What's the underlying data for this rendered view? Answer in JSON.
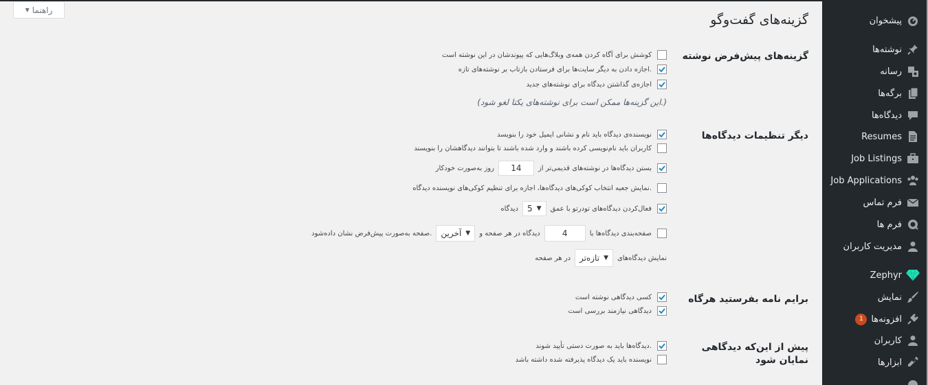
{
  "help_tab": {
    "label": "راهنما"
  },
  "page": {
    "title": "گزینه‌های گفت‌وگو"
  },
  "sections": {
    "default_post": {
      "heading": "گزینه‌های پیش‌فرض نوشته",
      "options": [
        {
          "label": "کوشش برای آگاه کردن همه‌ی وبلاگ‌هایی که پیوندشان در این نوشته است",
          "checked": false
        },
        {
          "label": "اجازه دادن به دیگر سایت‌ها برای فرستادن بازتاب بر نوشته‌های تازه.",
          "checked": true
        },
        {
          "label": "اجازه‌ی گذاشتن دیدگاه برای نوشته‌های جدید",
          "checked": true
        }
      ],
      "note": "(این گزینه‌ها ممکن است برای نوشته‌های یکتا لغو شود.)"
    },
    "other": {
      "heading": "دیگر تنظیمات دیدگاه‌ها",
      "require_name_email": {
        "label": "نویسنده‌ی دیدگاه باید نام و نشانی ایمیل خود را بنویسد",
        "checked": true
      },
      "registration_required": {
        "label": "کاربران باید نام‌نویسی کرده باشند و وارد شده باشند تا بتوانند دیدگاهشان را بنویسند",
        "checked": false
      },
      "close_comments": {
        "before": "بستن دیدگاه‌ها در نوشته‌های قدیمی‌تر از",
        "value": "14",
        "after": "روز به‌صورت خودکار",
        "checked": true
      },
      "cookies_optin": {
        "label": "نمایش جعبه انتخاب کوکی‌های دیدگاه‌ها، اجازه برای تنظیم کوکی‌های نویسنده دیدگاه.",
        "checked": false
      },
      "threaded": {
        "before": "فعال‌کردن دیدگاه‌های تودرتو با عمق",
        "value": "5",
        "after": "دیدگاه",
        "checked": true
      },
      "paged": {
        "before": "صفحه‌بندی دیدگاه‌ها با",
        "value": "4",
        "middle": "دیدگاه در هر صفحه و",
        "select": "آخرین",
        "after": "صفحه به‌صورت پیش‌فرض نشان داده‌شود.",
        "checked": false
      },
      "order": {
        "before": "نمایش دیدگاه‌های",
        "select": "تازه‌تر",
        "after": "در هر صفحه"
      }
    },
    "email_me": {
      "heading": "برایم نامه بفرستید هرگاه",
      "options": [
        {
          "label": "کسی دیدگاهی نوشته است",
          "checked": true
        },
        {
          "label": "دیدگاهی نیازمند بررسی است",
          "checked": true
        }
      ]
    },
    "before_appears": {
      "heading": "پیش از این‌که دیدگاهی نمایان شود",
      "options": [
        {
          "label": "دیدگاه‌ها باید به صورت دستی تأیید شوند.",
          "checked": true
        },
        {
          "label": "نویسنده باید یک دیدگاه پذیرفته شده داشته باشد",
          "checked": false
        }
      ]
    }
  },
  "sidebar": {
    "items": [
      {
        "label": "پیشخوان",
        "icon": "dashboard-icon"
      },
      {
        "label": "نوشته‌ها",
        "icon": "pin-icon"
      },
      {
        "label": "رسانه",
        "icon": "media-icon"
      },
      {
        "label": "برگه‌ها",
        "icon": "pages-icon"
      },
      {
        "label": "دیدگاه‌ها",
        "icon": "comments-icon"
      },
      {
        "label": "Resumes",
        "icon": "document-icon"
      },
      {
        "label": "Job Listings",
        "icon": "briefcase-icon"
      },
      {
        "label": "Job Applications",
        "icon": "groups-icon"
      },
      {
        "label": "فرم تماس",
        "icon": "mail-icon"
      },
      {
        "label": "فرم ها",
        "icon": "forms-icon"
      },
      {
        "label": "مدیریت کاربران",
        "icon": "user-icon"
      },
      {
        "label": "Zephyr",
        "icon": "diamond-icon"
      },
      {
        "label": "نمایش",
        "icon": "brush-icon"
      },
      {
        "label": "افزونه‌ها",
        "icon": "plugin-icon",
        "badge": "1"
      },
      {
        "label": "کاربران",
        "icon": "user-icon"
      },
      {
        "label": "ابزارها",
        "icon": "wrench-icon"
      },
      {
        "label": "",
        "icon": "more-icon"
      }
    ]
  },
  "colors": {
    "sidebar_bg": "#23282d",
    "accent": "#0073aa",
    "badge": "#ca4a1f",
    "zephyr": "#1ee0b5"
  }
}
